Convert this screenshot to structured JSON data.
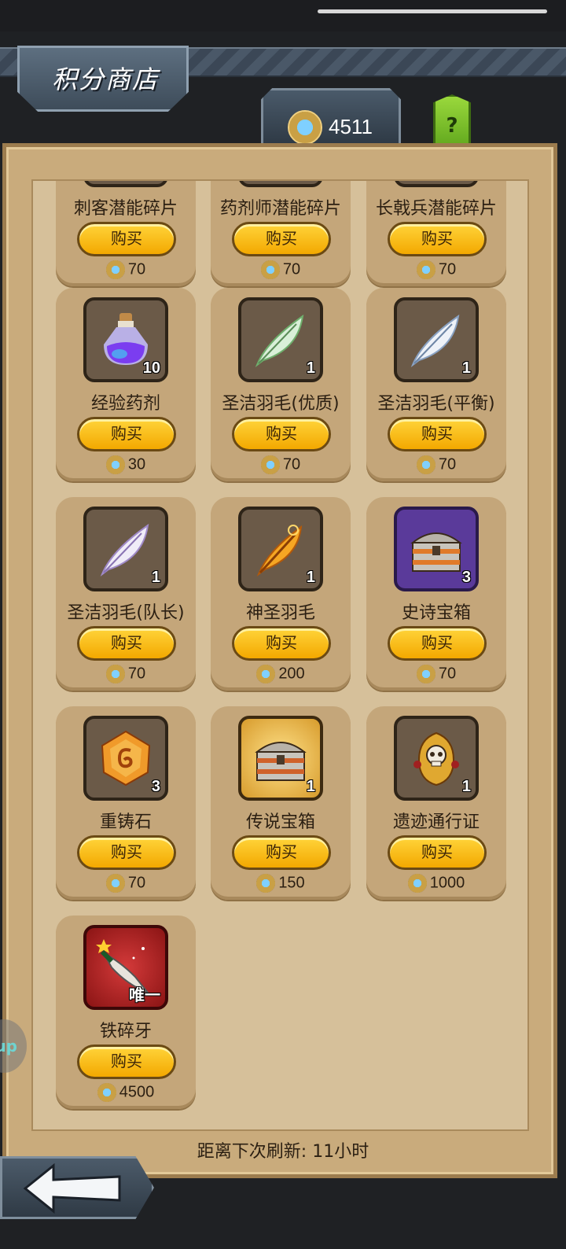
{
  "header": {
    "title": "积分商店",
    "currency_value": "4511",
    "help_label": "?"
  },
  "shop": {
    "buy_label": "购买",
    "refresh_text": "距离下次刷新: 11小时",
    "items": [
      {
        "name": "刺客潜能碎片",
        "price": "70",
        "qty": "",
        "icon": "assassin-shard-icon"
      },
      {
        "name": "药剂师潜能碎片",
        "price": "70",
        "qty": "",
        "icon": "alchemist-shard-icon"
      },
      {
        "name": "长戟兵潜能碎片",
        "price": "70",
        "qty": "",
        "icon": "halberdier-shard-icon"
      },
      {
        "name": "经验药剂",
        "price": "30",
        "qty": "10",
        "icon": "exp-potion-icon"
      },
      {
        "name": "圣洁羽毛(优质)",
        "price": "70",
        "qty": "1",
        "icon": "green-feather-icon"
      },
      {
        "name": "圣洁羽毛(平衡)",
        "price": "70",
        "qty": "1",
        "icon": "white-feather-icon"
      },
      {
        "name": "圣洁羽毛(队长)",
        "price": "70",
        "qty": "1",
        "icon": "purple-feather-icon"
      },
      {
        "name": "神圣羽毛",
        "price": "200",
        "qty": "1",
        "icon": "divine-feather-icon"
      },
      {
        "name": "史诗宝箱",
        "price": "70",
        "qty": "3",
        "icon": "epic-chest-icon"
      },
      {
        "name": "重铸石",
        "price": "70",
        "qty": "3",
        "icon": "reforge-stone-icon"
      },
      {
        "name": "传说宝箱",
        "price": "150",
        "qty": "1",
        "icon": "legend-chest-icon"
      },
      {
        "name": "遗迹通行证",
        "price": "1000",
        "qty": "1",
        "icon": "relic-pass-icon"
      },
      {
        "name": "铁碎牙",
        "price": "4500",
        "qty": "唯一",
        "icon": "iron-fang-icon"
      }
    ]
  },
  "side_bubble_text": "up",
  "colors": {
    "panel": "#c9ab7c",
    "button": "#f3a800",
    "help": "#7fc52a"
  }
}
